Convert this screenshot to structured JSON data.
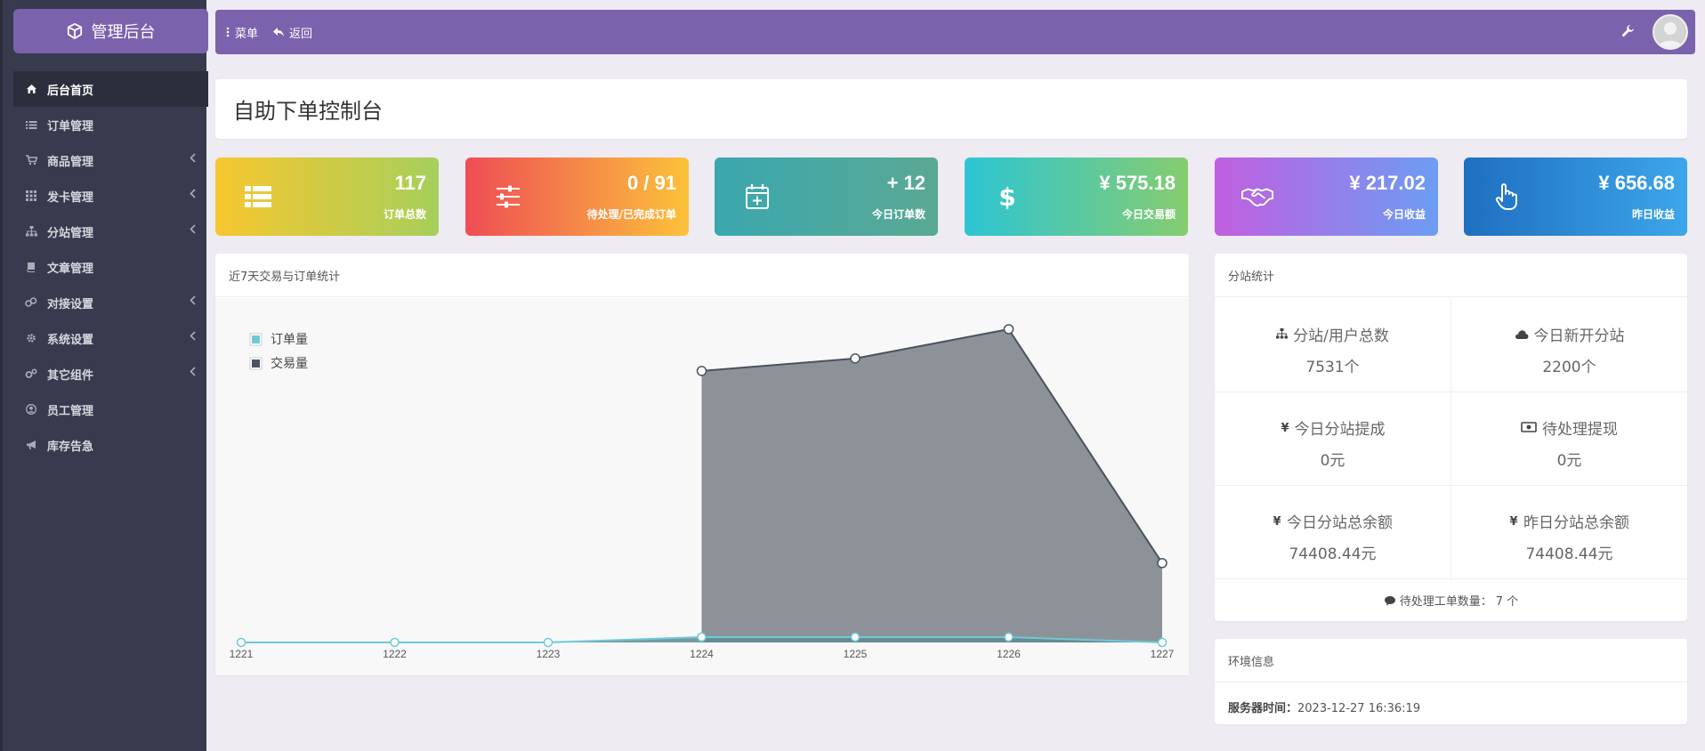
{
  "brand": {
    "title": "管理后台"
  },
  "sidebar": {
    "items": [
      {
        "label": "后台首页",
        "icon": "home-icon",
        "active": true,
        "has_children": false
      },
      {
        "label": "订单管理",
        "icon": "list-icon",
        "active": false,
        "has_children": false
      },
      {
        "label": "商品管理",
        "icon": "cart-icon",
        "active": false,
        "has_children": true
      },
      {
        "label": "发卡管理",
        "icon": "grid-icon",
        "active": false,
        "has_children": true
      },
      {
        "label": "分站管理",
        "icon": "sitemap-icon",
        "active": false,
        "has_children": true
      },
      {
        "label": "文章管理",
        "icon": "book-icon",
        "active": false,
        "has_children": false
      },
      {
        "label": "对接设置",
        "icon": "link-icon",
        "active": false,
        "has_children": true
      },
      {
        "label": "系统设置",
        "icon": "gear-icon",
        "active": false,
        "has_children": true
      },
      {
        "label": "其它组件",
        "icon": "gears-icon",
        "active": false,
        "has_children": true
      },
      {
        "label": "员工管理",
        "icon": "user-icon",
        "active": false,
        "has_children": false
      },
      {
        "label": "库存告急",
        "icon": "bullhorn-icon",
        "active": false,
        "has_children": false
      }
    ]
  },
  "topbar": {
    "menu_label": "菜单",
    "back_label": "返回"
  },
  "page": {
    "title": "自助下单控制台"
  },
  "stats": [
    {
      "value": "117",
      "label": "订单总数",
      "icon": "table-icon",
      "colors": [
        "#f7c72f",
        "#a6cf5b"
      ]
    },
    {
      "value": "0 / 91",
      "label": "待处理/已完成订单",
      "icon": "sliders-icon",
      "colors": [
        "#ef4d55",
        "#fcc23b"
      ]
    },
    {
      "value": "+ 12",
      "label": "今日订单数",
      "icon": "calendar-plus-icon",
      "colors": [
        "#3aa7ae",
        "#5aa993"
      ]
    },
    {
      "value": "¥ 575.18",
      "label": "今日交易额",
      "icon": "dollar-icon",
      "colors": [
        "#2cc5d4",
        "#86cc6f"
      ]
    },
    {
      "value": "¥ 217.02",
      "label": "今日收益",
      "icon": "handshake-icon",
      "colors": [
        "#c15fe0",
        "#6c9df3"
      ]
    },
    {
      "value": "¥ 656.68",
      "label": "昨日收益",
      "icon": "hand-pointer-icon",
      "colors": [
        "#1e6fc0",
        "#3da6ea"
      ]
    }
  ],
  "chart_panel": {
    "title": "近7天交易与订单统计"
  },
  "chart_data": {
    "type": "area",
    "categories": [
      "1221",
      "1222",
      "1223",
      "1224",
      "1225",
      "1226",
      "1227"
    ],
    "series": [
      {
        "name": "订单量",
        "values": [
          0,
          0,
          0,
          12,
          12,
          12,
          0
        ],
        "color": "#6fc9d4"
      },
      {
        "name": "交易量",
        "values": [
          0,
          0,
          0,
          650,
          680,
          750,
          190
        ],
        "color": "#4a5260"
      }
    ],
    "legend_position": "top-left",
    "grid": false
  },
  "sub_panel": {
    "title": "分站统计",
    "cells": [
      {
        "key": "分站/用户总数",
        "value": "7531个",
        "icon": "sitemap-icon"
      },
      {
        "key": "今日新开分站",
        "value": "2200个",
        "icon": "cloud-icon"
      },
      {
        "key": "今日分站提成",
        "value": "0元",
        "icon": "yen-icon"
      },
      {
        "key": "待处理提现",
        "value": "0元",
        "icon": "money-icon"
      },
      {
        "key": "今日分站总余额",
        "value": "74408.44元",
        "icon": "yen-icon"
      },
      {
        "key": "昨日分站总余额",
        "value": "74408.44元",
        "icon": "yen-icon"
      }
    ],
    "ticket_label": "待处理工单数量：",
    "ticket_value": "7 个"
  },
  "env_panel": {
    "title": "环境信息",
    "server_time_label": "服务器时间：",
    "server_time": "2023-12-27 16:36:19"
  }
}
